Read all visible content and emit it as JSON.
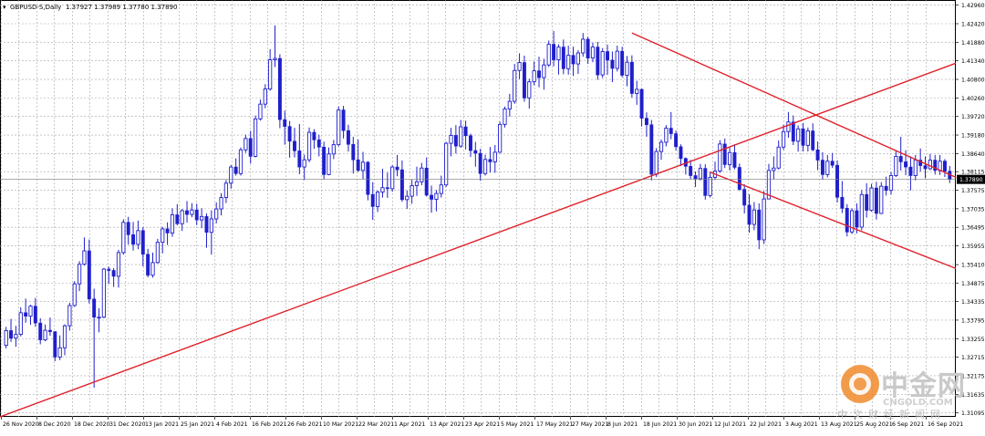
{
  "header": {
    "symbol": "GBPUSD-S,Daily",
    "ohlc": "1.37927 1.37989 1.37780 1.37890"
  },
  "watermark": {
    "name": "中金网",
    "domain": "CNGOLD.COM",
    "tagline": "中文财经新闻网"
  },
  "chart_data": {
    "type": "candlestick",
    "symbol": "GBPUSD-S",
    "timeframe": "Daily",
    "grid": true,
    "ylim": [
      1.3098,
      1.4311
    ],
    "y_ticks": [
      "1.42960",
      "1.42420",
      "1.41880",
      "1.41340",
      "1.40800",
      "1.40260",
      "1.39720",
      "1.39180",
      "1.38640",
      "1.38115",
      "1.37575",
      "1.37035",
      "1.36495",
      "1.35955",
      "1.35410",
      "1.34875",
      "1.34335",
      "1.33795",
      "1.33255",
      "1.32715",
      "1.32175",
      "1.31635",
      "1.31095"
    ],
    "x_ticks": [
      "26 Nov 2020",
      "8 Dec 2020",
      "18 Dec 2020",
      "31 Dec 2020",
      "13 Jan 2021",
      "25 Jan 2021",
      "4 Feb 2021",
      "16 Feb 2021",
      "26 Feb 2021",
      "10 Mar 2021",
      "22 Mar 2021",
      "1 Apr 2021",
      "13 Apr 2021",
      "23 Apr 2021",
      "5 May 2021",
      "17 May 2021",
      "27 May 2021",
      "8 Jun 2021",
      "18 Jun 2021",
      "30 Jun 2021",
      "12 Jul 2021",
      "22 Jul 2021",
      "3 Aug 2021",
      "13 Aug 2021",
      "25 Aug 2021",
      "6 Sep 2021",
      "16 Sep 2021"
    ],
    "current_price": "1.37890",
    "colors": {
      "bull": "#1f1fcc",
      "bear": "#1f1fcc",
      "grid": "#a6a6a6",
      "trendline": "#e0202a",
      "price_label_bg": "#000000"
    },
    "candles": [
      [
        1.3306,
        1.336,
        1.3297,
        1.3349
      ],
      [
        1.3349,
        1.3383,
        1.3316,
        1.3327
      ],
      [
        1.3327,
        1.3363,
        1.3302,
        1.3338
      ],
      [
        1.3338,
        1.3417,
        1.3332,
        1.3401
      ],
      [
        1.3401,
        1.3442,
        1.3372,
        1.3391
      ],
      [
        1.3391,
        1.3424,
        1.3366,
        1.342
      ],
      [
        1.342,
        1.3444,
        1.336,
        1.3371
      ],
      [
        1.3371,
        1.3385,
        1.3309,
        1.3322
      ],
      [
        1.3322,
        1.3367,
        1.3318,
        1.335
      ],
      [
        1.335,
        1.3387,
        1.3334,
        1.3346
      ],
      [
        1.3346,
        1.3347,
        1.326,
        1.3272
      ],
      [
        1.3272,
        1.3335,
        1.3263,
        1.3299
      ],
      [
        1.3299,
        1.3367,
        1.3277,
        1.3363
      ],
      [
        1.3363,
        1.343,
        1.3349,
        1.3422
      ],
      [
        1.3422,
        1.3493,
        1.3418,
        1.3485
      ],
      [
        1.3485,
        1.3551,
        1.3464,
        1.3542
      ],
      [
        1.3542,
        1.362,
        1.3538,
        1.3581
      ],
      [
        1.3581,
        1.3614,
        1.3428,
        1.3441
      ],
      [
        1.3441,
        1.3471,
        1.3183,
        1.3388
      ],
      [
        1.3388,
        1.3414,
        1.3344,
        1.3388
      ],
      [
        1.3388,
        1.3531,
        1.3385,
        1.3528
      ],
      [
        1.3528,
        1.3535,
        1.3485,
        1.3524
      ],
      [
        1.3524,
        1.3531,
        1.3476,
        1.3507
      ],
      [
        1.3507,
        1.3584,
        1.3474,
        1.3576
      ],
      [
        1.3576,
        1.3673,
        1.357,
        1.3664
      ],
      [
        1.3664,
        1.368,
        1.3599,
        1.3628
      ],
      [
        1.3628,
        1.3665,
        1.3582,
        1.36
      ],
      [
        1.36,
        1.3669,
        1.3586,
        1.364
      ],
      [
        1.364,
        1.365,
        1.3536,
        1.3571
      ],
      [
        1.3571,
        1.3587,
        1.3504,
        1.351
      ],
      [
        1.351,
        1.3576,
        1.3503,
        1.3547
      ],
      [
        1.3547,
        1.3616,
        1.3544,
        1.3606
      ],
      [
        1.3606,
        1.3651,
        1.3574,
        1.3645
      ],
      [
        1.3645,
        1.3664,
        1.3598,
        1.3633
      ],
      [
        1.3633,
        1.3705,
        1.3622,
        1.3686
      ],
      [
        1.3686,
        1.3717,
        1.3655,
        1.366
      ],
      [
        1.366,
        1.3703,
        1.3639,
        1.3698
      ],
      [
        1.3698,
        1.3726,
        1.3663,
        1.3687
      ],
      [
        1.3687,
        1.372,
        1.3679,
        1.37
      ],
      [
        1.37,
        1.3718,
        1.3656,
        1.3671
      ],
      [
        1.3671,
        1.3705,
        1.3647,
        1.3681
      ],
      [
        1.3681,
        1.369,
        1.359,
        1.3635
      ],
      [
        1.3635,
        1.3699,
        1.357,
        1.3674
      ],
      [
        1.3674,
        1.3722,
        1.3661,
        1.3703
      ],
      [
        1.3703,
        1.3749,
        1.3684,
        1.3736
      ],
      [
        1.3736,
        1.3787,
        1.372,
        1.3778
      ],
      [
        1.3778,
        1.3831,
        1.3762,
        1.3825
      ],
      [
        1.3825,
        1.385,
        1.38,
        1.3806
      ],
      [
        1.3806,
        1.3882,
        1.38,
        1.3875
      ],
      [
        1.3875,
        1.3919,
        1.3866,
        1.3908
      ],
      [
        1.3908,
        1.393,
        1.3835,
        1.3856
      ],
      [
        1.3856,
        1.3975,
        1.3853,
        1.3965
      ],
      [
        1.3965,
        1.4021,
        1.396,
        1.4008
      ],
      [
        1.4008,
        1.4066,
        1.3996,
        1.4052
      ],
      [
        1.4052,
        1.4168,
        1.4047,
        1.4137
      ],
      [
        1.4137,
        1.4237,
        1.4116,
        1.4141
      ],
      [
        1.4141,
        1.4153,
        1.3938,
        1.3963
      ],
      [
        1.3963,
        1.3989,
        1.389,
        1.3943
      ],
      [
        1.3943,
        1.3959,
        1.3852,
        1.39
      ],
      [
        1.39,
        1.3939,
        1.3853,
        1.3872
      ],
      [
        1.3872,
        1.395,
        1.3804,
        1.3825
      ],
      [
        1.3825,
        1.3861,
        1.3787,
        1.3846
      ],
      [
        1.3846,
        1.394,
        1.3839,
        1.3926
      ],
      [
        1.3926,
        1.3935,
        1.3878,
        1.3904
      ],
      [
        1.3904,
        1.3919,
        1.3856,
        1.3883
      ],
      [
        1.3883,
        1.3899,
        1.379,
        1.3803
      ],
      [
        1.3803,
        1.3882,
        1.3801,
        1.3863
      ],
      [
        1.3863,
        1.3904,
        1.3848,
        1.389
      ],
      [
        1.389,
        1.4001,
        1.3885,
        1.3991
      ],
      [
        1.3991,
        1.4003,
        1.3908,
        1.3931
      ],
      [
        1.3931,
        1.3948,
        1.387,
        1.3891
      ],
      [
        1.3891,
        1.3913,
        1.3806,
        1.3846
      ],
      [
        1.3846,
        1.3905,
        1.3811,
        1.3815
      ],
      [
        1.3815,
        1.3869,
        1.379,
        1.3839
      ],
      [
        1.3839,
        1.3842,
        1.3728,
        1.3745
      ],
      [
        1.3745,
        1.3781,
        1.3671,
        1.371
      ],
      [
        1.371,
        1.3757,
        1.3694,
        1.3752
      ],
      [
        1.3752,
        1.382,
        1.3736,
        1.3765
      ],
      [
        1.3765,
        1.3809,
        1.3735,
        1.3762
      ],
      [
        1.3762,
        1.383,
        1.3753,
        1.3825
      ],
      [
        1.3825,
        1.386,
        1.3798,
        1.3817
      ],
      [
        1.3817,
        1.3844,
        1.3724,
        1.373
      ],
      [
        1.373,
        1.3757,
        1.3703,
        1.374
      ],
      [
        1.374,
        1.3788,
        1.3718,
        1.3771
      ],
      [
        1.3771,
        1.3826,
        1.3741,
        1.3782
      ],
      [
        1.3782,
        1.3837,
        1.3772,
        1.3822
      ],
      [
        1.3822,
        1.3853,
        1.3739,
        1.3743
      ],
      [
        1.3743,
        1.3771,
        1.3692,
        1.3731
      ],
      [
        1.3731,
        1.3758,
        1.3696,
        1.3748
      ],
      [
        1.3748,
        1.38,
        1.3736,
        1.3773
      ],
      [
        1.3773,
        1.3898,
        1.3767,
        1.3894
      ],
      [
        1.3894,
        1.3939,
        1.3856,
        1.3917
      ],
      [
        1.3917,
        1.3947,
        1.3864,
        1.3886
      ],
      [
        1.3886,
        1.3962,
        1.3881,
        1.3942
      ],
      [
        1.3942,
        1.396,
        1.3876,
        1.3916
      ],
      [
        1.3916,
        1.3922,
        1.3854,
        1.3873
      ],
      [
        1.3873,
        1.3898,
        1.3826,
        1.3865
      ],
      [
        1.3865,
        1.3878,
        1.3785,
        1.3806
      ],
      [
        1.3806,
        1.3861,
        1.38,
        1.3847
      ],
      [
        1.3847,
        1.3883,
        1.3809,
        1.384
      ],
      [
        1.384,
        1.3889,
        1.3808,
        1.3868
      ],
      [
        1.3868,
        1.3957,
        1.3866,
        1.3949
      ],
      [
        1.3949,
        1.4001,
        1.394,
        1.3994
      ],
      [
        1.3994,
        1.4038,
        1.3972,
        1.4016
      ],
      [
        1.4016,
        1.4125,
        1.4009,
        1.4106
      ],
      [
        1.4106,
        1.4156,
        1.4081,
        1.4129
      ],
      [
        1.4129,
        1.4149,
        1.4015,
        1.4026
      ],
      [
        1.4026,
        1.4082,
        1.3995,
        1.4073
      ],
      [
        1.4073,
        1.4132,
        1.4063,
        1.4105
      ],
      [
        1.4105,
        1.4146,
        1.4057,
        1.4085
      ],
      [
        1.4085,
        1.414,
        1.405,
        1.4122
      ],
      [
        1.4122,
        1.4193,
        1.4116,
        1.4182
      ],
      [
        1.4182,
        1.4221,
        1.4118,
        1.4137
      ],
      [
        1.4137,
        1.4182,
        1.4094,
        1.4174
      ],
      [
        1.4174,
        1.4196,
        1.4095,
        1.4111
      ],
      [
        1.4111,
        1.4178,
        1.4094,
        1.415
      ],
      [
        1.415,
        1.4175,
        1.409,
        1.4125
      ],
      [
        1.4125,
        1.4165,
        1.4096,
        1.4157
      ],
      [
        1.4157,
        1.4215,
        1.4146,
        1.4197
      ],
      [
        1.4197,
        1.4204,
        1.4125,
        1.4142
      ],
      [
        1.4142,
        1.4187,
        1.413,
        1.4174
      ],
      [
        1.4174,
        1.4189,
        1.4079,
        1.4093
      ],
      [
        1.4093,
        1.4171,
        1.4084,
        1.4161
      ],
      [
        1.4161,
        1.4181,
        1.4093,
        1.4136
      ],
      [
        1.4136,
        1.4161,
        1.4072,
        1.4112
      ],
      [
        1.4112,
        1.4178,
        1.4103,
        1.4162
      ],
      [
        1.4162,
        1.4175,
        1.4086,
        1.4092
      ],
      [
        1.4092,
        1.4148,
        1.406,
        1.413
      ],
      [
        1.413,
        1.415,
        1.4027,
        1.4039
      ],
      [
        1.4039,
        1.4076,
        1.4006,
        1.4051
      ],
      [
        1.4051,
        1.4053,
        1.3943,
        1.3967
      ],
      [
        1.3967,
        1.3984,
        1.3913,
        1.3948
      ],
      [
        1.3948,
        1.3962,
        1.3786,
        1.3804
      ],
      [
        1.3804,
        1.388,
        1.3796,
        1.387
      ],
      [
        1.387,
        1.3905,
        1.3846,
        1.3897
      ],
      [
        1.3897,
        1.3947,
        1.3885,
        1.3938
      ],
      [
        1.3938,
        1.3985,
        1.3906,
        1.3922
      ],
      [
        1.3922,
        1.3931,
        1.3873,
        1.3884
      ],
      [
        1.3884,
        1.3891,
        1.3828,
        1.385
      ],
      [
        1.385,
        1.3853,
        1.3803,
        1.3827
      ],
      [
        1.3827,
        1.3846,
        1.3791,
        1.38
      ],
      [
        1.38,
        1.3812,
        1.3767,
        1.3791
      ],
      [
        1.3791,
        1.3834,
        1.3786,
        1.3821
      ],
      [
        1.3821,
        1.3833,
        1.373,
        1.3742
      ],
      [
        1.3742,
        1.3811,
        1.3736,
        1.3795
      ],
      [
        1.3795,
        1.3841,
        1.3787,
        1.3813
      ],
      [
        1.3813,
        1.3903,
        1.3808,
        1.3892
      ],
      [
        1.3892,
        1.3908,
        1.3822,
        1.3832
      ],
      [
        1.3832,
        1.3882,
        1.3815,
        1.3867
      ],
      [
        1.3867,
        1.3891,
        1.3818,
        1.3824
      ],
      [
        1.3824,
        1.3835,
        1.3756,
        1.376
      ],
      [
        1.376,
        1.3775,
        1.369,
        1.3714
      ],
      [
        1.3714,
        1.3746,
        1.3634,
        1.3658
      ],
      [
        1.3658,
        1.3723,
        1.3641,
        1.37
      ],
      [
        1.37,
        1.3719,
        1.3586,
        1.3613
      ],
      [
        1.3613,
        1.3755,
        1.3601,
        1.3732
      ],
      [
        1.3732,
        1.3834,
        1.3731,
        1.3815
      ],
      [
        1.3815,
        1.3856,
        1.379,
        1.3822
      ],
      [
        1.3822,
        1.3902,
        1.3818,
        1.3883
      ],
      [
        1.3883,
        1.3948,
        1.3875,
        1.3928
      ],
      [
        1.3928,
        1.3985,
        1.391,
        1.3956
      ],
      [
        1.3956,
        1.3975,
        1.3889,
        1.39
      ],
      [
        1.39,
        1.3946,
        1.387,
        1.3936
      ],
      [
        1.3936,
        1.3953,
        1.387,
        1.3888
      ],
      [
        1.3888,
        1.394,
        1.387,
        1.393
      ],
      [
        1.393,
        1.3952,
        1.3871,
        1.3875
      ],
      [
        1.3875,
        1.3899,
        1.3816,
        1.3845
      ],
      [
        1.3845,
        1.3868,
        1.3788,
        1.3803
      ],
      [
        1.3803,
        1.386,
        1.3795,
        1.3842
      ],
      [
        1.3842,
        1.3866,
        1.3822,
        1.383
      ],
      [
        1.383,
        1.3844,
        1.3722,
        1.3737
      ],
      [
        1.3737,
        1.3784,
        1.3691,
        1.3705
      ],
      [
        1.3705,
        1.3717,
        1.3623,
        1.3636
      ],
      [
        1.3636,
        1.3705,
        1.363,
        1.3698
      ],
      [
        1.3698,
        1.3719,
        1.3632,
        1.365
      ],
      [
        1.365,
        1.3758,
        1.3641,
        1.3745
      ],
      [
        1.3745,
        1.3778,
        1.3678,
        1.3699
      ],
      [
        1.3699,
        1.3776,
        1.3695,
        1.3764
      ],
      [
        1.3764,
        1.3782,
        1.3672,
        1.369
      ],
      [
        1.369,
        1.3781,
        1.3688,
        1.3769
      ],
      [
        1.3769,
        1.3797,
        1.3742,
        1.3757
      ],
      [
        1.3757,
        1.381,
        1.3745,
        1.38
      ],
      [
        1.38,
        1.3874,
        1.3796,
        1.3856
      ],
      [
        1.3856,
        1.3913,
        1.3815,
        1.384
      ],
      [
        1.384,
        1.3874,
        1.3801,
        1.3825
      ],
      [
        1.3825,
        1.3856,
        1.3757,
        1.38
      ],
      [
        1.38,
        1.386,
        1.3786,
        1.3845
      ],
      [
        1.3845,
        1.3879,
        1.3812,
        1.3829
      ],
      [
        1.3829,
        1.3856,
        1.3792,
        1.382
      ],
      [
        1.382,
        1.3863,
        1.3816,
        1.3845
      ],
      [
        1.3845,
        1.386,
        1.3803,
        1.3815
      ],
      [
        1.3815,
        1.386,
        1.3802,
        1.3842
      ],
      [
        1.3842,
        1.3848,
        1.3796,
        1.3813
      ],
      [
        1.3813,
        1.3828,
        1.3778,
        1.3789
      ]
    ],
    "trendlines": [
      {
        "name": "rising-support",
        "from": [
          0,
          1.3098
        ],
        "to": [
          223,
          1.4127
        ]
      },
      {
        "name": "falling-upper",
        "from": [
          128,
          1.4215
        ],
        "to": [
          223,
          1.3795
        ]
      },
      {
        "name": "falling-lower",
        "from": [
          144,
          1.381
        ],
        "to": [
          223,
          1.353
        ]
      }
    ]
  }
}
